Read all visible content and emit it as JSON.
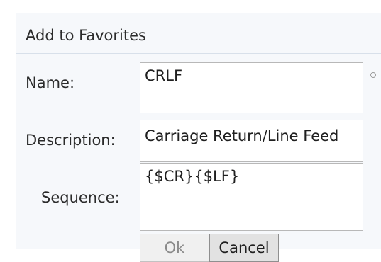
{
  "dialog": {
    "title": "Add to Favorites",
    "name_label": "Name:",
    "name_value": "CRLF",
    "description_label": "Description:",
    "description_value": "Carriage Return/Line Feed",
    "sequence_label": "Sequence:",
    "sequence_value": "{$CR}{$LF}",
    "ok_label": "Ok",
    "cancel_label": "Cancel",
    "pin_icon": "circle-icon"
  },
  "colors": {
    "background": "#f6f8fb",
    "text": "#2b2b2b",
    "field_border": "#b8b8b8",
    "disabled_text": "#8a8a8a"
  }
}
